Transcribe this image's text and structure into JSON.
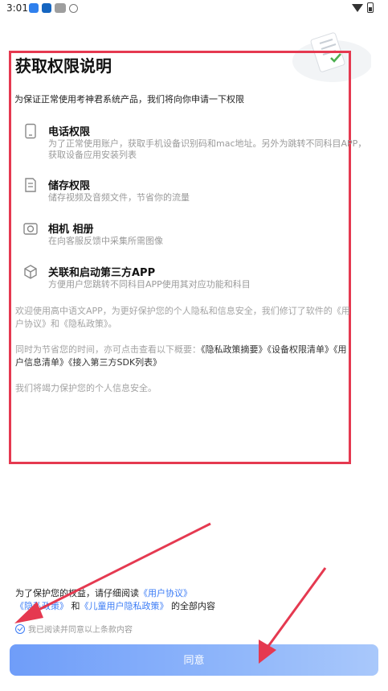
{
  "status_bar": {
    "time": "3:01"
  },
  "header": {
    "title": "获取权限说明"
  },
  "intro": "为保证正常使用考神君系统产品，我们将向你申请一下权限",
  "permissions": [
    {
      "icon": "phone-icon",
      "title": "电话权限",
      "desc": "为了正常使用账户，获取手机设备识别码和mac地址。另外为跳转不同科目APP，\n获取设备应用安装列表"
    },
    {
      "icon": "storage-icon",
      "title": "储存权限",
      "desc": "储存视频及音频文件，节省你的流量"
    },
    {
      "icon": "camera-icon",
      "title": "相机 相册",
      "desc": "在向客服反馈中采集所需图像"
    },
    {
      "icon": "cube-icon",
      "title": "关联和启动第三方APP",
      "desc": "方便用户您跳转不同科目APP使用其对应功能和科目"
    }
  ],
  "notice": {
    "p1": "欢迎使用高中语文APP，为更好保护您的个人隐私和信息安全，我们修订了软件的《用户协议》和《隐私政策》。",
    "p2_prefix": "同时为节省您的时间，亦可点击查看以下概要：",
    "p2_links": [
      "《隐私政策摘要》",
      "《设备权限清单》",
      "《用户信息清单》",
      "《接入第三方SDK列表》"
    ],
    "p3": "我们将竭力保护您的个人信息安全。"
  },
  "bottom": {
    "line1_prefix": "为了保护您的权益，请仔细阅读",
    "link_user_agreement": "《用户协议》",
    "link_privacy": "《隐私政策》",
    "and": "和",
    "link_child_privacy": "《儿童用户隐私政策》",
    "line2_suffix": "的全部内容",
    "checkbox_label": "我已阅读并同意以上条款内容",
    "agree_button": "同意"
  },
  "colors": {
    "accent": "#3a7bf6",
    "highlight_box": "#e53950",
    "annotation_arrow": "#e53950"
  }
}
